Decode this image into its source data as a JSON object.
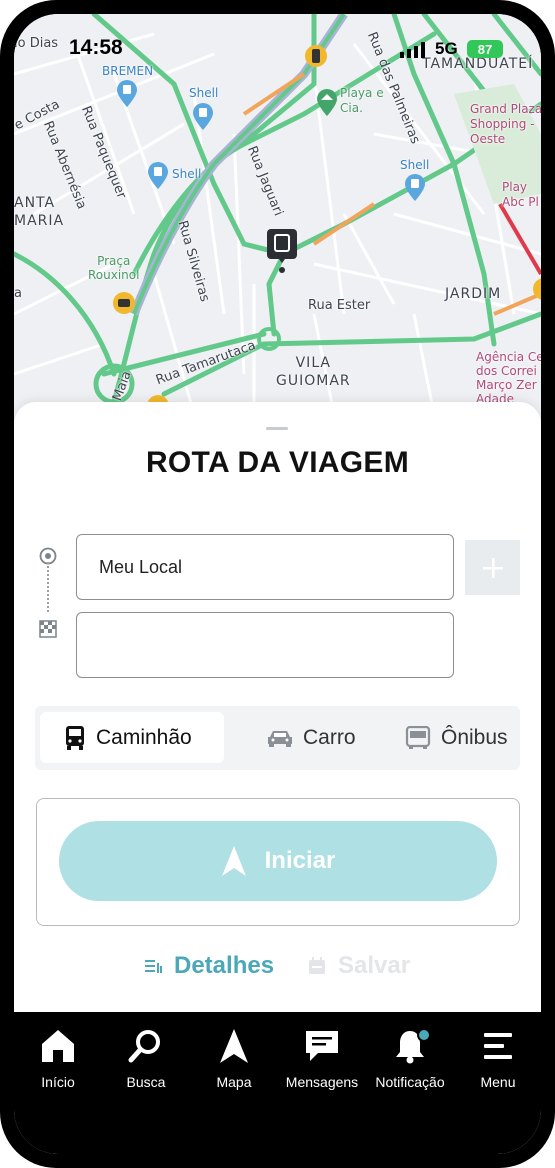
{
  "status_bar": {
    "time": "14:58",
    "network": "5G",
    "battery": "87"
  },
  "map": {
    "labels": {
      "rio_dias": "io Dias",
      "bremen": "BREMEN",
      "shell_1": "Shell",
      "shell_2": "Shell",
      "shell_3": "Shell",
      "playa": "Playa e\nCia.",
      "tamanduatei": "TAMANDUATEÍ",
      "grand_plaza": "Grand Plaza\nShopping -\nOeste",
      "play_abc": "Play\nAbc Pl",
      "costa": "e Costa",
      "rua_abernesia": "Rua Abernésia",
      "rua_paquequer": "Rua Paquequer",
      "rua_palmeiras": "Rua das Palmeiras",
      "rua_jaguari": "Rua Jaguari",
      "santa_maria": "ANTA\nMARIA",
      "rua_silveiras": "Rua Silveiras",
      "praca": "Praça\nRouxinol",
      "rua_ester": "Rua Ester",
      "jardim": "JARDIM",
      "rua_tamarutaca": "Rua Tamarutaca",
      "vila_guiomar": "VILA\nGUIOMAR",
      "maia": "Maia",
      "agencia": "Agência Ce\ndos Correi\nMarço Zer\nAdade",
      "a_label": "a"
    }
  },
  "sheet": {
    "title": "ROTA DA VIAGEM",
    "origin_value": "Meu Local",
    "destination_value": "",
    "modes": [
      {
        "label": "Caminhão",
        "icon": "truck-icon",
        "active": true
      },
      {
        "label": "Carro",
        "icon": "car-icon",
        "active": false
      },
      {
        "label": "Ônibus",
        "icon": "bus-icon",
        "active": false
      }
    ],
    "start_label": "Iniciar",
    "details_label": "Detalhes",
    "save_label": "Salvar"
  },
  "colors": {
    "accent": "#4aa8b8",
    "start_button": "#aee0e4",
    "road_green": "#63c98a"
  },
  "nav": {
    "items": [
      {
        "label": "Início",
        "icon": "home-icon"
      },
      {
        "label": "Busca",
        "icon": "search-icon"
      },
      {
        "label": "Mapa",
        "icon": "navigation-arrow-icon"
      },
      {
        "label": "Mensagens",
        "icon": "message-icon"
      },
      {
        "label": "Notificação",
        "icon": "bell-icon"
      },
      {
        "label": "Menu",
        "icon": "menu-icon"
      }
    ]
  }
}
